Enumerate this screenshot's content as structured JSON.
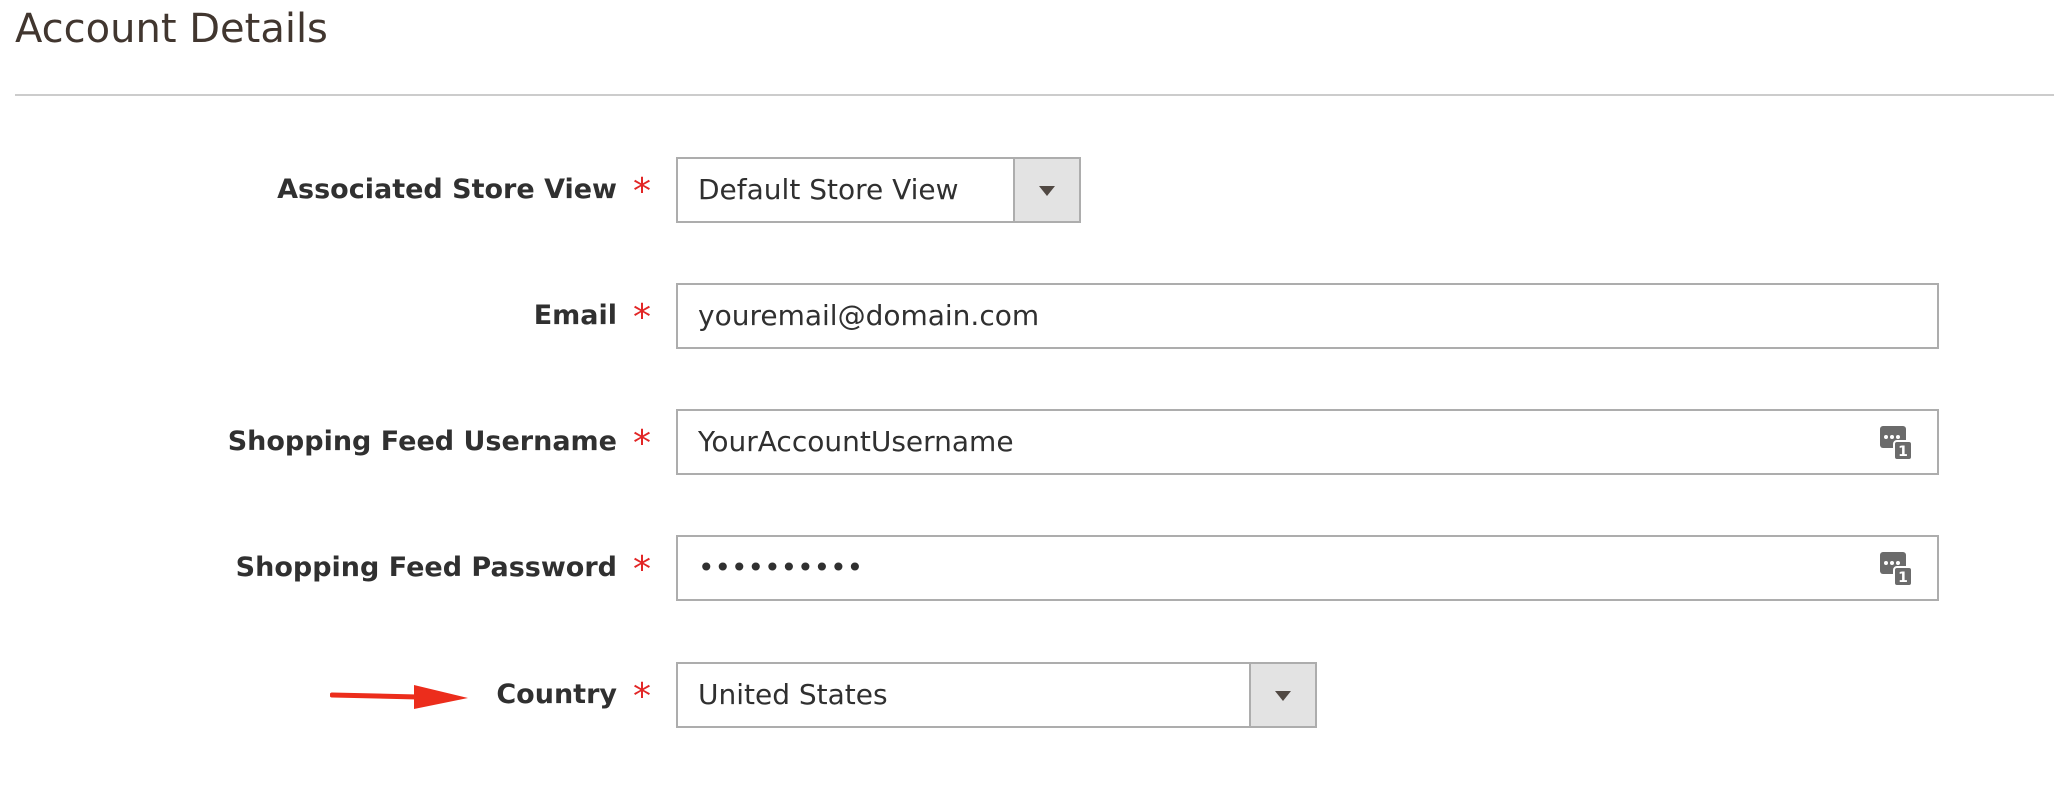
{
  "section": {
    "title": "Account Details"
  },
  "fields": {
    "store_view": {
      "label": "Associated Store View",
      "required_mark": "*",
      "value": "Default Store View"
    },
    "email": {
      "label": "Email",
      "required_mark": "*",
      "value": "youremail@domain.com"
    },
    "username": {
      "label": "Shopping Feed Username",
      "required_mark": "*",
      "value": "YourAccountUsername"
    },
    "password": {
      "label": "Shopping Feed Password",
      "required_mark": "*",
      "value": "••••••••••"
    },
    "country": {
      "label": "Country",
      "required_mark": "*",
      "value": "United States"
    }
  },
  "icons": {
    "select_toggle": "chevron-down-icon",
    "autofill": "password-manager-icon",
    "annotation": "red-arrow-icon"
  },
  "colors": {
    "required": "#e22626",
    "border": "#adadad",
    "toggle_bg": "#e3e3e3",
    "arrow": "#ec2d1c"
  }
}
